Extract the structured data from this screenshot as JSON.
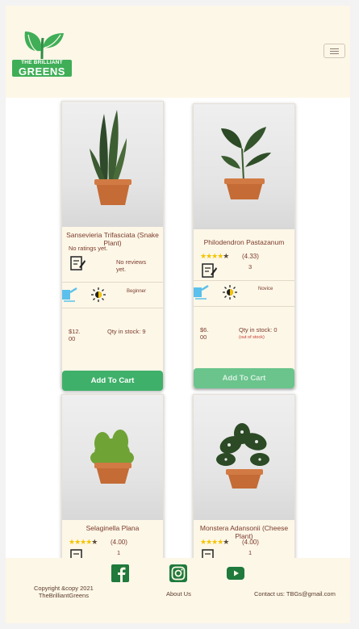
{
  "brand": {
    "line1": "THE BRILLIANT",
    "line2": "GREENS"
  },
  "menu": {
    "icon": "hamburger-icon"
  },
  "products": [
    {
      "name": "Sansevieria Trifasciata (Snake Plant)",
      "rating_text": "No ratings yet.",
      "reviews_text": "No reviews yet.",
      "level": "Beginner",
      "price": "$12.00",
      "qty": "Qty in stock: 9",
      "stock_note": "",
      "button": "Add To Cart"
    },
    {
      "name": "Philodendron Pastazanum",
      "rating": 4.33,
      "rating_text": "(4.33)",
      "reviews_text": "3",
      "level": "Novice",
      "price": "$6.00",
      "qty": "Qty in stock: 0",
      "stock_note": "(out of stock)",
      "button": "Add To Cart"
    },
    {
      "name": "Selaginella Plana",
      "rating": 4.0,
      "rating_text": "(4.00)",
      "reviews_text": "1"
    },
    {
      "name": "Monstera Adansonii (Cheese Plant)",
      "rating": 4.0,
      "rating_text": "(4.00)",
      "reviews_text": "1"
    }
  ],
  "footer": {
    "copyright": "Copyright &copy 2021",
    "owner": "TheBrilliantGreens",
    "about": "About Us",
    "contact": "Contact us: TBGs@gmail.com",
    "social": [
      "facebook-icon",
      "instagram-icon",
      "youtube-icon"
    ]
  },
  "colors": {
    "accent": "#3fb06a",
    "cream": "#fdf7e8",
    "text": "#7a3b2a",
    "star": "#f4c400"
  }
}
